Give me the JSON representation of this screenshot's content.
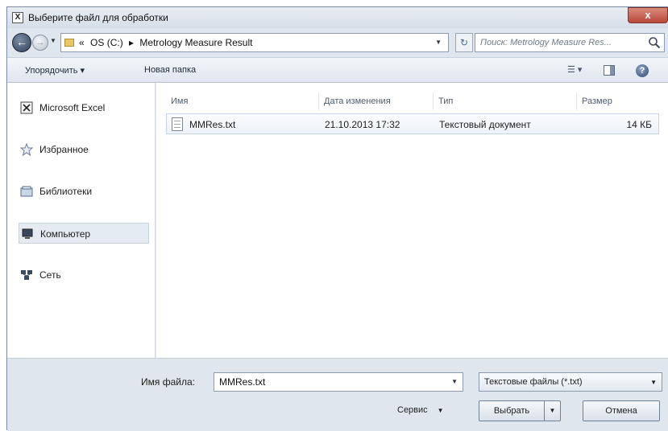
{
  "window": {
    "title": "Выберите файл для обработки",
    "close_glyph": "x"
  },
  "address": {
    "prefix": "«",
    "crumbs": [
      "OS (C:)",
      "Metrology Measure Result"
    ],
    "separator": "▸"
  },
  "search": {
    "placeholder": "Поиск: Metrology Measure Res..."
  },
  "toolbar": {
    "organize_label": "Упорядочить ▾",
    "new_folder_label": "Новая папка",
    "views_label": "☰ ▾",
    "help_glyph": "?"
  },
  "nav": {
    "items": [
      {
        "label": "Microsoft Excel",
        "icon": "excel-icon"
      },
      {
        "label": "Избранное",
        "icon": "star-icon"
      },
      {
        "label": "Библиотеки",
        "icon": "library-icon"
      },
      {
        "label": "Компьютер",
        "icon": "computer-icon",
        "selected": true
      },
      {
        "label": "Сеть",
        "icon": "network-icon"
      }
    ]
  },
  "columns": {
    "name": "Имя",
    "date": "Дата изменения",
    "type": "Тип",
    "size": "Размер"
  },
  "files": [
    {
      "name": "MMRes.txt",
      "date": "21.10.2013 17:32",
      "type": "Текстовый документ",
      "size": "14 КБ"
    }
  ],
  "footer": {
    "filename_label": "Имя файла:",
    "filename_value": "MMRes.txt",
    "filter_value": "Текстовые файлы (*.txt)",
    "service_label": "Сервис",
    "open_label": "Выбрать",
    "cancel_label": "Отмена"
  },
  "colors": {
    "window_bg": "#dfe6ee",
    "close_button": "#b9483a",
    "selection": "#e5ebf2"
  }
}
